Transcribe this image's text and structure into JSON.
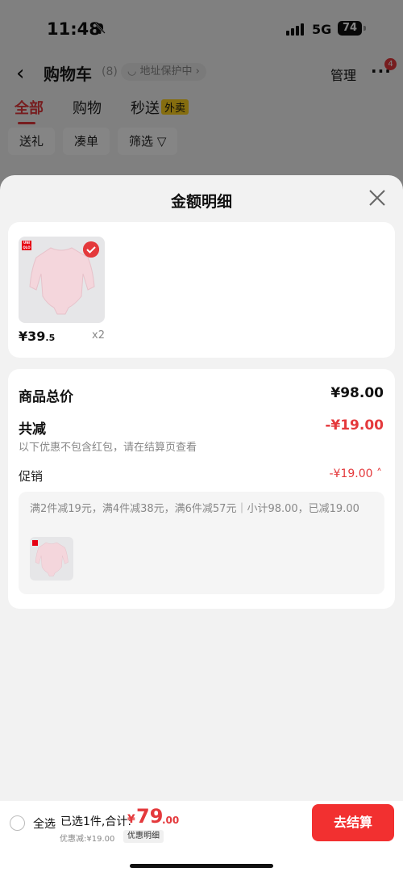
{
  "status": {
    "time": "11:48",
    "network": "5G",
    "battery": "74"
  },
  "nav": {
    "title": "购物车",
    "count": "(8)",
    "address": "地址保护中",
    "manage": "管理",
    "more": "···",
    "badge": "4"
  },
  "tabs": [
    {
      "label": "全部"
    },
    {
      "label": "购物"
    },
    {
      "label": "秒送",
      "tag": "外卖"
    }
  ],
  "filters": [
    "送礼",
    "凑单",
    "筛选"
  ],
  "sheet": {
    "title": "金额明细",
    "product": {
      "brand": "UNI QLO",
      "price_symbol": "¥",
      "price_int": "39",
      "price_dec": ".5",
      "qty": "x2"
    },
    "total_label": "商品总价",
    "total_value": "¥98.00",
    "reduce_label": "共减",
    "reduce_value": "-¥19.00",
    "note": "以下优惠不包含红包，请在结算页查看",
    "promo_label": "促销",
    "promo_value": "-¥19.00",
    "promo_text": "满2件减19元，满4件减38元，满6件减57元｜小计98.00，已减19.00"
  },
  "bottom": {
    "select_all": "全选",
    "summary": "已选1件,合计:",
    "total_symbol": "¥",
    "total_int": "79",
    "total_dec": ".00",
    "discount": "优惠减:¥19.00",
    "detail_label": "优惠明细",
    "checkout": "去结算"
  },
  "colors": {
    "accent": "#e4393c",
    "checkout": "#f23030",
    "tag": "#ffd21e"
  }
}
